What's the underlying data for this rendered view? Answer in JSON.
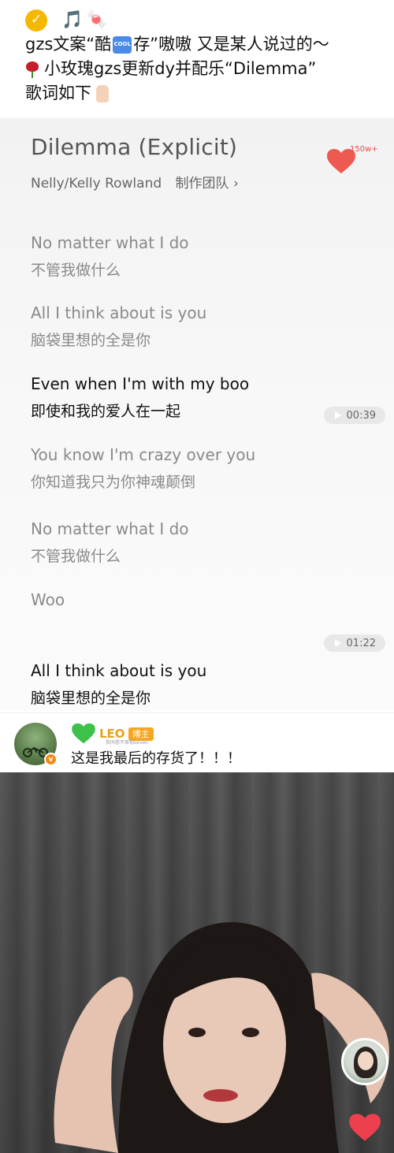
{
  "post": {
    "line1_music": "🎵",
    "line1_candy": "🍬",
    "line2_a": "gzs文案“酷",
    "line2_cool": "COOL",
    "line2_b": "存”嗷嗷 又是某人说过的～",
    "line3_text": "小玫瑰gzs更新dy并配乐“Dilemma”",
    "line4_text": "歌词如下"
  },
  "song": {
    "title": "Dilemma (Explicit)",
    "artists": "Nelly/Kelly Rowland",
    "credits_label": "制作团队",
    "credits_chevron": "›",
    "like_count": "150w+"
  },
  "lyrics": [
    {
      "en": "No matter what I do",
      "zh": "不管我做什么"
    },
    {
      "en": "All I think about is you",
      "zh": "脑袋里想的全是你"
    },
    {
      "en": "Even when I'm with my boo",
      "zh": "即使和我的爱人在一起"
    },
    {
      "en": "You know I'm crazy over you",
      "zh": "你知道我只为你神魂颠倒"
    },
    {
      "en": "No matter what I do",
      "zh": "不管我做什么"
    },
    {
      "en": "Woo",
      "zh": ""
    },
    {
      "en": "All I think about is you",
      "zh": "脑袋里想的全是你"
    }
  ],
  "timestamps": [
    "00:39",
    "01:22"
  ],
  "comment": {
    "username": "LEO",
    "badge": "博主",
    "sub_note": "我叫卷不审视seven",
    "text": "这是我最后的存货了！！！"
  },
  "colors": {
    "accent_red": "#e84a4a",
    "verified_orange": "#f28a1a",
    "badge_yellow": "#f5b800"
  }
}
